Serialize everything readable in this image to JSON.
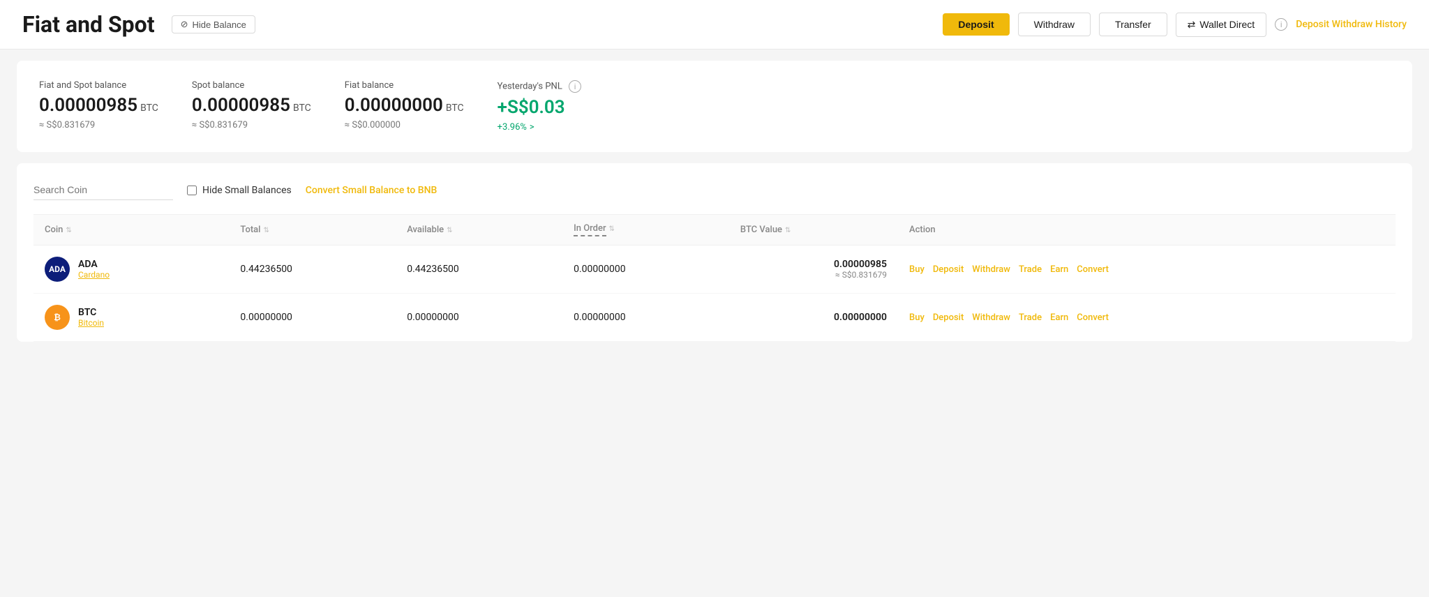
{
  "header": {
    "title": "Fiat and Spot",
    "hide_balance_label": "Hide Balance",
    "deposit_label": "Deposit",
    "withdraw_label": "Withdraw",
    "transfer_label": "Transfer",
    "wallet_direct_label": "Wallet Direct",
    "history_label": "Deposit Withdraw History"
  },
  "balance": {
    "fiat_spot_label": "Fiat and Spot balance",
    "fiat_spot_value": "0.00000985",
    "fiat_spot_unit": "BTC",
    "fiat_spot_approx": "≈ S$0.831679",
    "spot_label": "Spot balance",
    "spot_value": "0.00000985",
    "spot_unit": "BTC",
    "spot_approx": "≈ S$0.831679",
    "fiat_label": "Fiat balance",
    "fiat_value": "0.00000000",
    "fiat_unit": "BTC",
    "fiat_approx": "≈ S$0.000000",
    "pnl_label": "Yesterday's PNL",
    "pnl_value": "+S$0.03",
    "pnl_percent": "+3.96%"
  },
  "toolbar": {
    "search_placeholder": "Search Coin",
    "hide_small_balances_label": "Hide Small Balances",
    "convert_small_label": "Convert Small Balance to BNB"
  },
  "table": {
    "columns": [
      "Coin",
      "Total",
      "Available",
      "In Order",
      "BTC Value",
      "Action"
    ],
    "rows": [
      {
        "symbol": "ADA",
        "fullname": "Cardano",
        "icon_class": "ada",
        "icon_text": "ADA",
        "total": "0.44236500",
        "available": "0.44236500",
        "in_order": "0.00000000",
        "btc_value": "0.00000985",
        "btc_approx": "≈ S$0.831679",
        "actions": [
          "Buy",
          "Deposit",
          "Withdraw",
          "Trade",
          "Earn",
          "Convert"
        ]
      },
      {
        "symbol": "BTC",
        "fullname": "Bitcoin",
        "icon_class": "btc",
        "icon_text": "₿",
        "total": "0.00000000",
        "available": "0.00000000",
        "in_order": "0.00000000",
        "btc_value": "0.00000000",
        "btc_approx": "",
        "actions": [
          "Buy",
          "Deposit",
          "Withdraw",
          "Trade",
          "Earn",
          "Convert"
        ]
      }
    ]
  }
}
